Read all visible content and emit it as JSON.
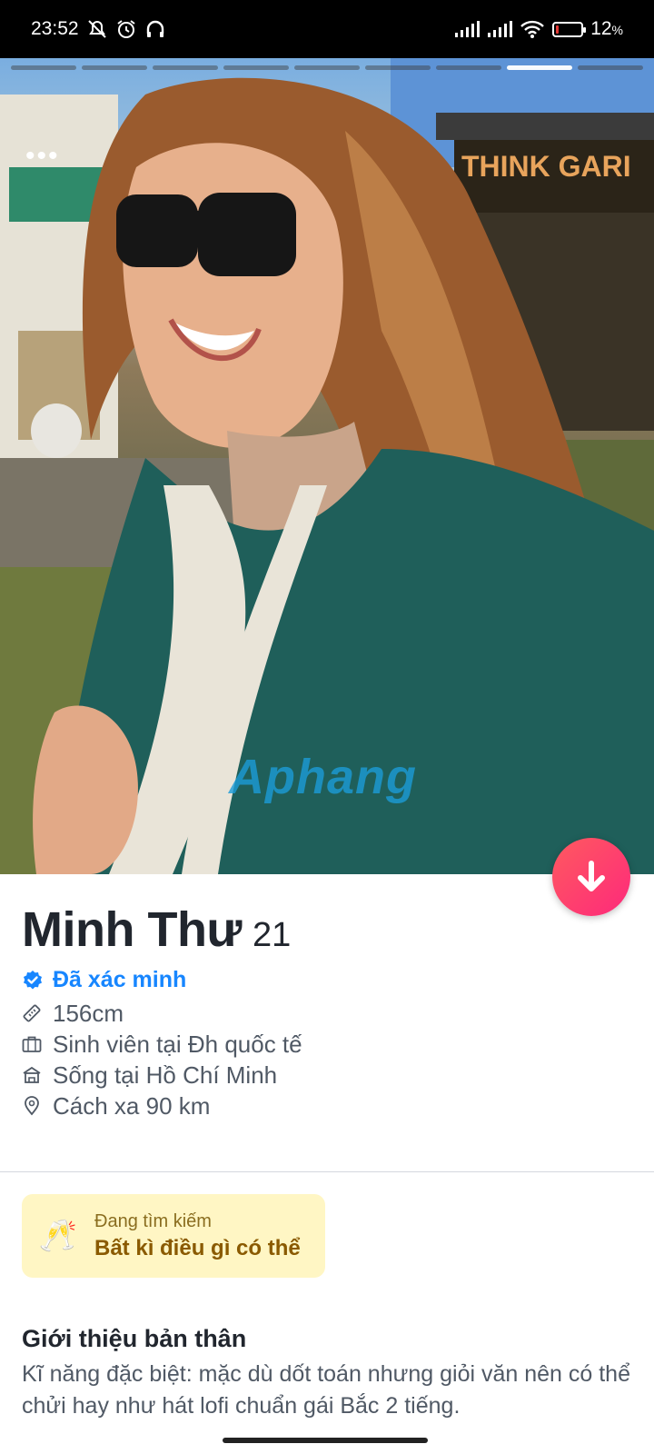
{
  "status_bar": {
    "time": "23:52",
    "battery": "12",
    "battery_level": 0.12,
    "icons": [
      "mute-icon",
      "alarm-icon",
      "headphones-icon",
      "signal-icon",
      "signal-icon",
      "wifi-icon",
      "battery-icon"
    ]
  },
  "photo": {
    "segments_total": 9,
    "active_segment": 8,
    "watermark": "Aphang"
  },
  "profile": {
    "name": "Minh Thư",
    "age": "21",
    "verified": "Đã xác minh",
    "height": "156cm",
    "job": "Sinh viên tại Đh quốc tế",
    "lives_in": "Sống tại Hồ Chí Minh",
    "distance": "Cách xa 90 km"
  },
  "looking_for": {
    "label": "Đang tìm kiếm",
    "value": "Bất kì điều gì có thể"
  },
  "about": {
    "title": "Giới thiệu bản thân",
    "text": "Kĩ năng đặc biệt: mặc dù dốt toán nhưng giỏi văn nên có thể chửi hay như hát lofi chuẩn gái Bắc 2 tiếng."
  },
  "colors": {
    "accent_verified": "#1786ff",
    "fab_gradient_start": "#ff5a5f",
    "fab_gradient_end": "#fd297b",
    "looking_bg": "#fff6c4"
  }
}
